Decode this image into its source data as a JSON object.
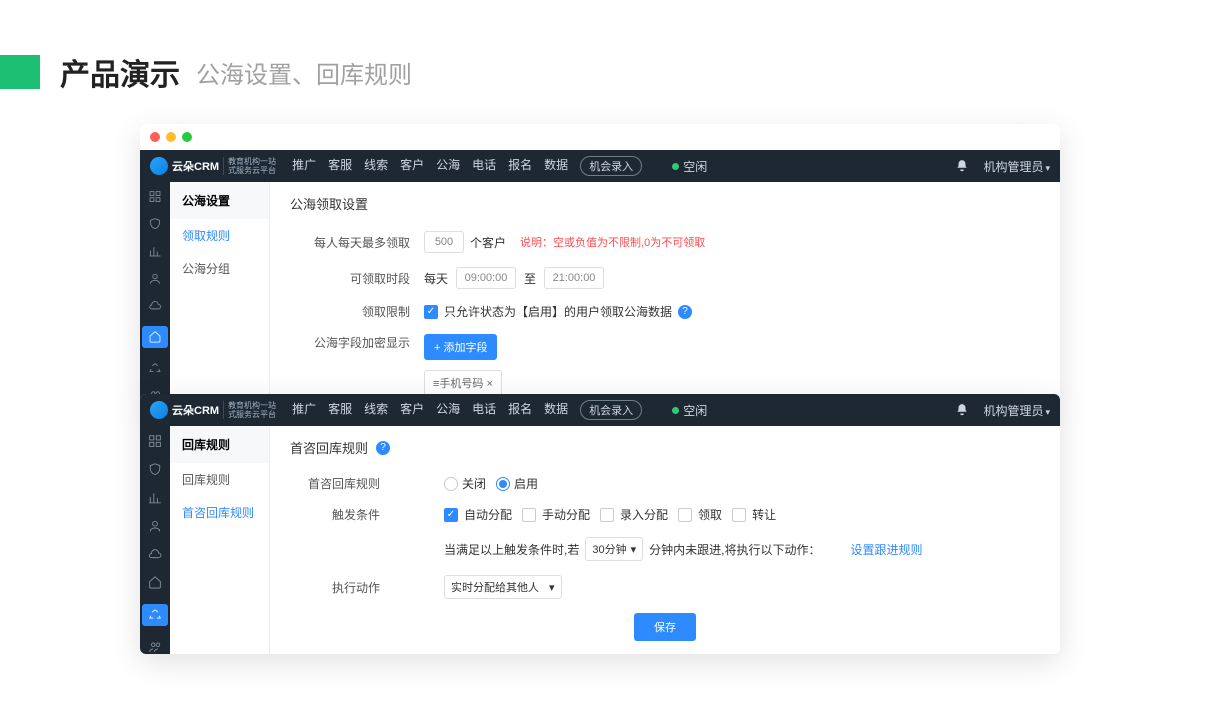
{
  "slide": {
    "title": "产品演示",
    "subtitle": "公海设置、回库规则"
  },
  "brand": {
    "name": "云朵CRM",
    "tagline": "教育机构一站\n式服务云平台"
  },
  "topnav": [
    "推广",
    "客服",
    "线索",
    "客户",
    "公海",
    "电话",
    "报名",
    "数据"
  ],
  "entry": "机会录入",
  "status": "空闲",
  "user": "机构管理员",
  "winA": {
    "sideTitle": "公海设置",
    "sideItems": [
      "领取规则",
      "公海分组"
    ],
    "section": "公海领取设置",
    "rows": {
      "r1": {
        "label": "每人每天最多领取",
        "value": "500",
        "unit": "个客户",
        "noteKey": "说明：",
        "noteBody": "空或负值为不限制,0为不可领取"
      },
      "r2": {
        "label": "可领取时段",
        "pre": "每天",
        "from": "09:00:00",
        "to": "至",
        "toVal": "21:00:00"
      },
      "r3": {
        "label": "领取限制",
        "text": "只允许状态为【启用】的用户领取公海数据"
      },
      "r4": {
        "label": "公海字段加密显示",
        "btn": "+ 添加字段",
        "tag": "≡手机号码 ×"
      }
    }
  },
  "winB": {
    "sideTitle": "回库规则",
    "sideItems": [
      "回库规则",
      "首咨回库规则"
    ],
    "section": "首咨回库规则",
    "rows": {
      "r1": {
        "label": "首咨回库规则",
        "off": "关闭",
        "on": "启用"
      },
      "r2": {
        "label": "触发条件",
        "opts": [
          "自动分配",
          "手动分配",
          "录入分配",
          "领取",
          "转让"
        ]
      },
      "r3": {
        "pre": "当满足以上触发条件时,若",
        "sel": "30分钟",
        "post": "分钟内未跟进,将执行以下动作：",
        "link": "设置跟进规则"
      },
      "r4": {
        "label": "执行动作",
        "sel": "实时分配给其他人"
      },
      "save": "保存"
    }
  }
}
